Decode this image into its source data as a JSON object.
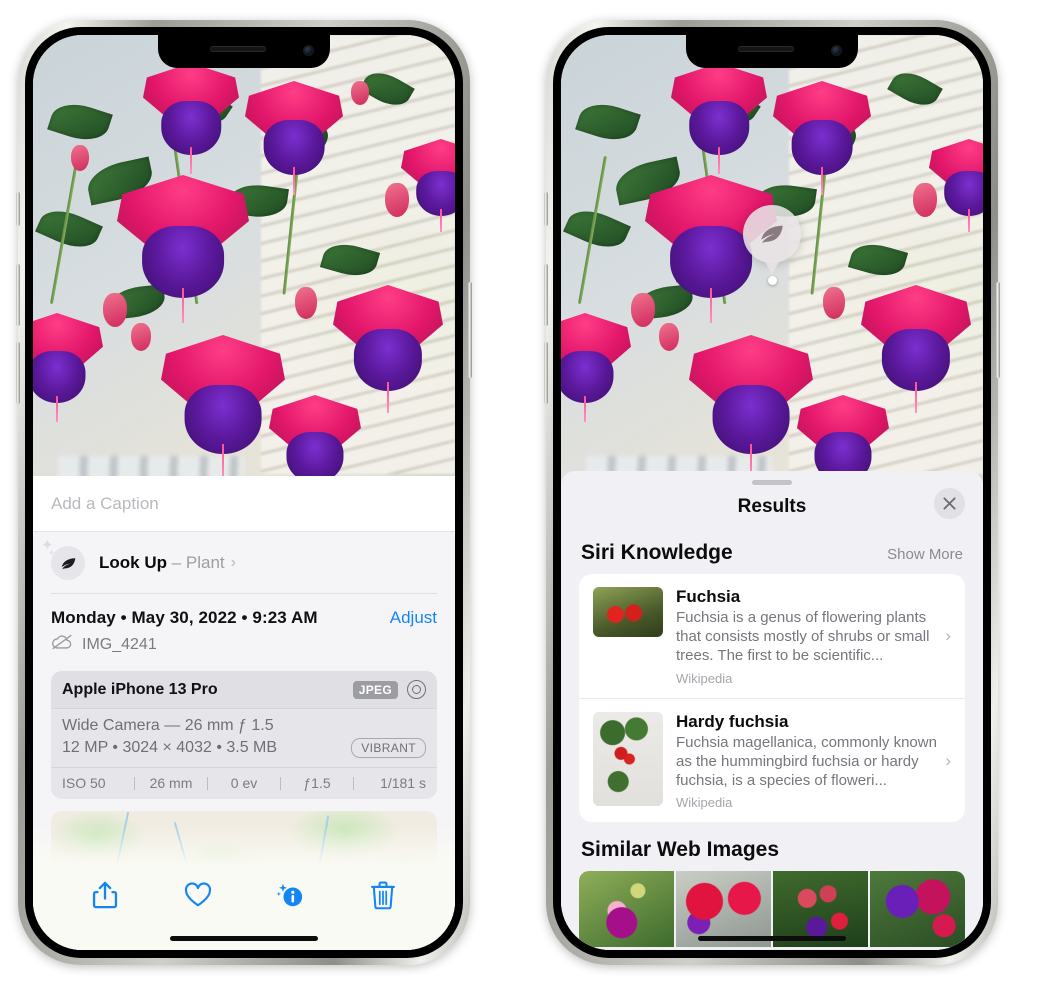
{
  "left_phone": {
    "caption": {
      "placeholder": "Add a Caption",
      "value": ""
    },
    "look_up": {
      "label": "Look Up",
      "dash": " – ",
      "subject": "Plant",
      "chevron": "›",
      "icon": "leaf-icon"
    },
    "date_line": {
      "text": "Monday • May 30, 2022 • 9:23 AM",
      "adjust_label": "Adjust"
    },
    "file": {
      "name": "IMG_4241",
      "icon": "icloud-slash-icon"
    },
    "camera_card": {
      "device": "Apple iPhone 13 Pro",
      "format_badge": "JPEG",
      "lens_icon": "lens-icon",
      "lens_line": "Wide Camera — 26 mm ƒ 1.5",
      "specs_line": "12 MP • 3024 × 4032 • 3.5 MB",
      "style_badge": "VIBRANT",
      "exif": [
        {
          "label": "ISO 50"
        },
        {
          "label": "26 mm"
        },
        {
          "label": "0 ev"
        },
        {
          "label": "ƒ1.5"
        },
        {
          "label": "1/181 s"
        }
      ]
    },
    "toolbar": [
      {
        "name": "share-button",
        "icon": "share-icon"
      },
      {
        "name": "favorite-button",
        "icon": "heart-icon"
      },
      {
        "name": "info-button",
        "icon": "info-sparkle-icon"
      },
      {
        "name": "delete-button",
        "icon": "trash-icon"
      }
    ]
  },
  "right_phone": {
    "visual_look_up_badge": {
      "icon": "leaf-icon"
    },
    "sheet": {
      "title": "Results",
      "close_label": "✕",
      "siri_knowledge": {
        "title": "Siri Knowledge",
        "show_more": "Show More",
        "items": [
          {
            "title": "Fuchsia",
            "description": "Fuchsia is a genus of flowering plants that consists mostly of shrubs or small trees. The first to be scientific...",
            "source": "Wikipedia",
            "chevron": "›"
          },
          {
            "title": "Hardy fuchsia",
            "description": "Fuchsia magellanica, commonly known as the hummingbird fuchsia or hardy fuchsia, is a species of floweri...",
            "source": "Wikipedia",
            "chevron": "›"
          }
        ]
      },
      "similar_web_images": {
        "title": "Similar Web Images",
        "thumbs": [
          "fuchsia-thumb-1",
          "fuchsia-thumb-2",
          "fuchsia-thumb-3",
          "fuchsia-thumb-4"
        ]
      }
    }
  },
  "colors": {
    "accent_blue": "#1486f4",
    "sheet_bg": "#f1f1f5",
    "card_bg": "#ffffff",
    "secondary_text": "#76767d"
  }
}
